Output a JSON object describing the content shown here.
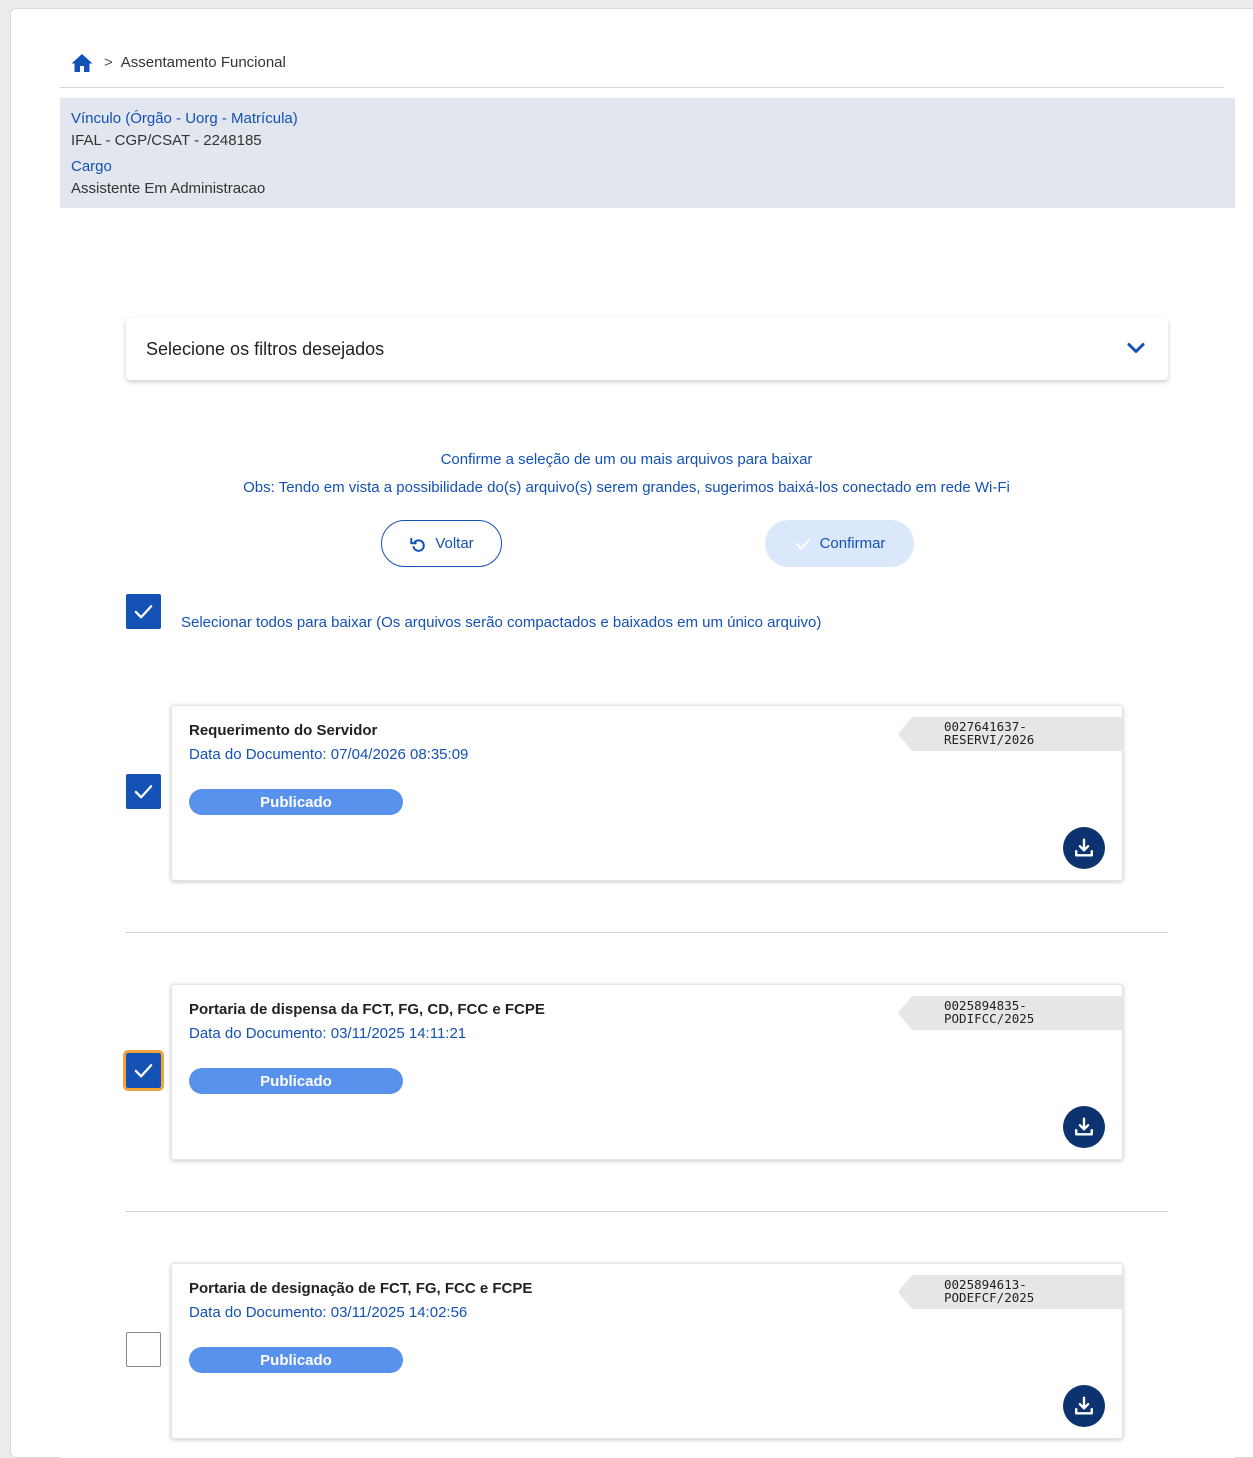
{
  "breadcrumb": {
    "home_icon": "home-icon",
    "separator": ">",
    "current": "Assentamento Funcional"
  },
  "info": {
    "vinculo_label": "Vínculo (Órgão - Uorg - Matrícula)",
    "vinculo_value": "IFAL - CGP/CSAT - 2248185",
    "cargo_label": "Cargo",
    "cargo_value": "Assistente Em Administracao"
  },
  "filter": {
    "title": "Selecione os filtros desejados",
    "icon": "chevron-down-icon"
  },
  "messages": {
    "confirm": "Confirme a seleção de um ou mais arquivos para baixar",
    "note": "Obs: Tendo em vista a possibilidade do(s) arquivo(s) serem grandes, sugerimos baixá-los conectado em rede Wi-Fi"
  },
  "buttons": {
    "back": "Voltar",
    "confirm": "Confirmar"
  },
  "select_all": {
    "label": "Selecionar todos para baixar (Os arquivos serão compactados e baixados em um único arquivo)",
    "checked": true
  },
  "documents": [
    {
      "title": "Requerimento do Servidor",
      "date": "Data do Documento: 07/04/2026 08:35:09",
      "status": "Publicado",
      "code_line1": "0027641637-",
      "code_line2": "RESERVI/2026",
      "checked": true
    },
    {
      "title": "Portaria de dispensa da FCT, FG, CD, FCC e FCPE",
      "date": "Data do Documento: 03/11/2025 14:11:21",
      "status": "Publicado",
      "code_line1": "0025894835-",
      "code_line2": "PODIFCC/2025",
      "checked": true
    },
    {
      "title": "Portaria de designação de FCT, FG, FCC e FCPE",
      "date": "Data do Documento: 03/11/2025 14:02:56",
      "status": "Publicado",
      "code_line1": "0025894613-",
      "code_line2": "PODEFCF/2025",
      "checked": false
    }
  ],
  "colors": {
    "primary": "#1351b4",
    "dark_blue": "#0c326f",
    "badge": "#5992ed",
    "info_bg": "#e2e6ee",
    "focus": "#f2a33a"
  }
}
